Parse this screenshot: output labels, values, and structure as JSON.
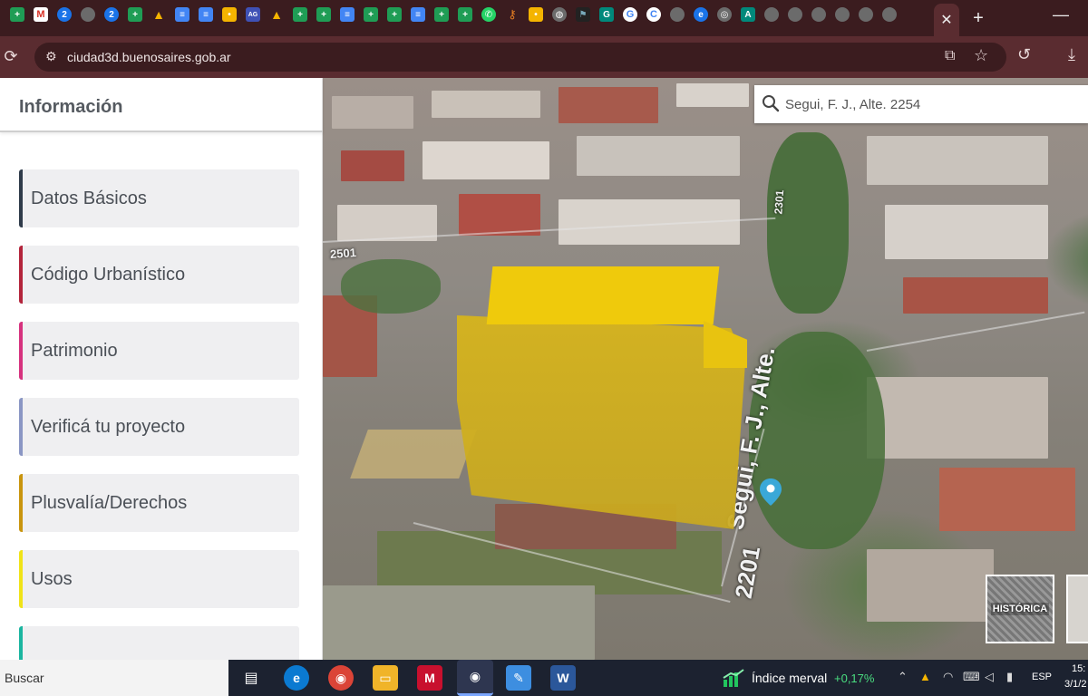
{
  "browser": {
    "url": "ciudad3d.buenosaires.gob.ar",
    "active_tab_close": "✕",
    "new_tab": "+",
    "minimize": "—",
    "tab_favicons": [
      "sheets-icon",
      "gmail-icon",
      "blue-circle-icon",
      "grey-circle-icon",
      "blue-circle-icon",
      "sheets-icon",
      "drive-icon",
      "docs-icon",
      "docs-icon",
      "keep-icon",
      "ag-icon",
      "drive-icon",
      "sheets-icon",
      "sheets-icon",
      "docs-icon",
      "sheets-icon",
      "sheets-icon",
      "docs-icon",
      "sheets-icon",
      "sheets-icon",
      "whatsapp-icon",
      "key-icon",
      "keep-icon",
      "globe-icon",
      "flag-icon",
      "g-icon",
      "google-icon",
      "c-icon",
      "grey-circle-icon",
      "edge-icon",
      "chrome-icon",
      "a-icon",
      "grey-circle-icon",
      "grey-circle-icon",
      "grey-circle-icon",
      "grey-circle-icon",
      "grey-circle-icon",
      "grey-circle-icon"
    ]
  },
  "sidepanel": {
    "title": "Información",
    "items": [
      {
        "label": "Datos Básicos",
        "accent": "#2f3b4a"
      },
      {
        "label": "Código Urbanístico",
        "accent": "#b3243b"
      },
      {
        "label": "Patrimonio",
        "accent": "#d6327e"
      },
      {
        "label": "Verificá tu proyecto",
        "accent": "#8a96c4"
      },
      {
        "label": "Plusvalía/Derechos",
        "accent": "#c9950e"
      },
      {
        "label": "Usos",
        "accent": "#f0e318"
      },
      {
        "label": "",
        "accent": "#1bb5a0"
      }
    ]
  },
  "map": {
    "search_value": "Segui, F. J., Alte. 2254",
    "street_labels": [
      "2501",
      "2301",
      "2201",
      "Segui, F. J., Alte."
    ],
    "historica_label": "HISTÓRICA",
    "building_color": "#e6c216",
    "pin_color": "#3aa8d8"
  },
  "taskbar": {
    "search_label": "Buscar",
    "apps": [
      "task-view-icon",
      "edge-icon",
      "chrome-icon",
      "file-explorer-icon",
      "mcafee-icon",
      "chrome-profile-icon",
      "paint-icon",
      "word-icon"
    ],
    "merval_label": "Índice merval",
    "merval_change": "+0,17%",
    "language": "ESP",
    "time": "15:",
    "date": "3/1/2"
  }
}
